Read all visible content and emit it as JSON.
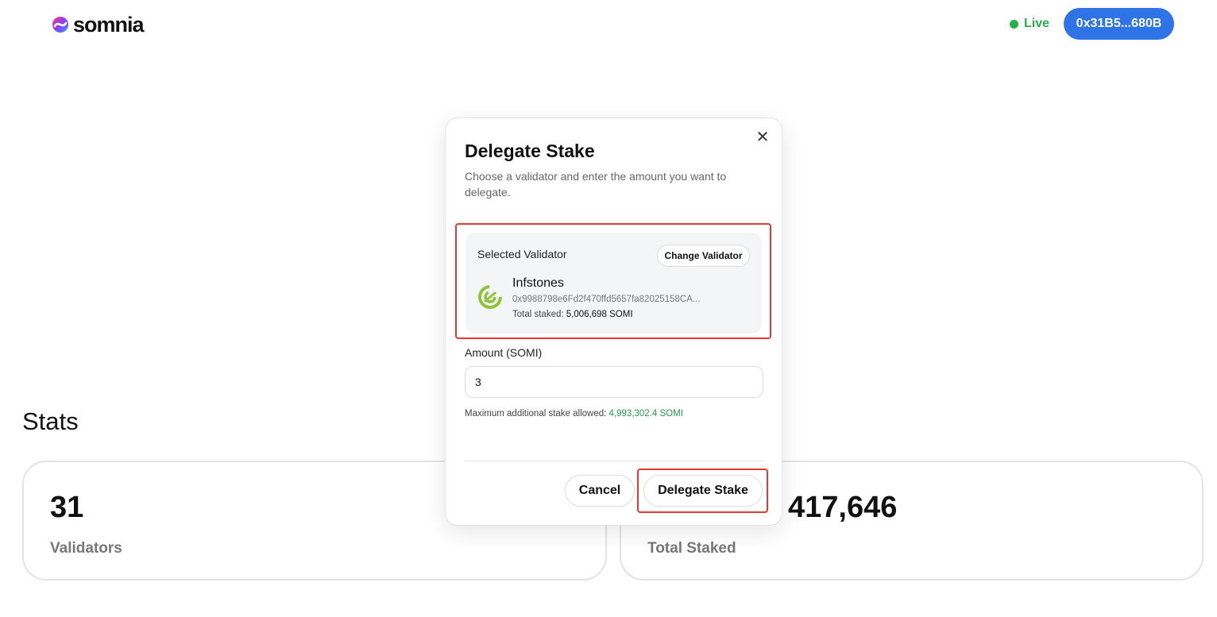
{
  "header": {
    "logo_text": "somnia",
    "status_label": "Live",
    "wallet_label": "0x31B5...680B",
    "status_color": "#22b14c",
    "wallet_color": "#2f74e6"
  },
  "stats": {
    "title": "Stats",
    "cards": [
      {
        "value": "31",
        "label": "Validators"
      },
      {
        "value": "417,646",
        "label": "Total Staked"
      }
    ]
  },
  "modal": {
    "title": "Delegate Stake",
    "description": "Choose a validator and enter the amount you want to delegate.",
    "close_icon": "close-icon",
    "validator": {
      "section_label": "Selected Validator",
      "change_label": "Change Validator",
      "name": "Infstones",
      "address": "0x9988798e6Fd2f470ffd5657fa82025158CA...",
      "total_staked_label": "Total staked:",
      "total_staked_value": "5,006,698 SOMI",
      "icon": "infstones-logo-icon"
    },
    "amount": {
      "label": "Amount (SOMI)",
      "value": "3",
      "max_label": "Maximum additional stake allowed:",
      "max_value": "4,993,302.4 SOMI"
    },
    "cancel_label": "Cancel",
    "submit_label": "Delegate Stake",
    "highlight_color": "#e53935",
    "accent_green": "#1f9c4a"
  }
}
